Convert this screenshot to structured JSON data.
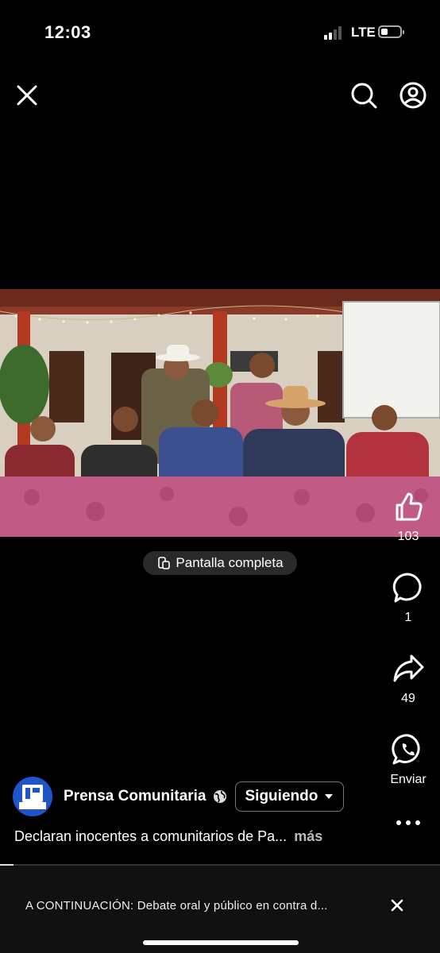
{
  "status_bar": {
    "time": "12:03",
    "network": "LTE",
    "battery_level": 0.35
  },
  "header": {
    "close_icon": "close-icon",
    "search_icon": "search-icon",
    "profile_icon": "profile-icon"
  },
  "video": {
    "fullscreen_label": "Pantalla completa",
    "progress": 0.03
  },
  "actions": {
    "like_count": "103",
    "comment_count": "1",
    "share_count": "49",
    "send_label": "Enviar"
  },
  "post": {
    "author": "Prensa Comunitaria",
    "avatar_text": "Prensa",
    "follow_label": "Siguiendo",
    "caption": "Declaran inocentes a comunitarios de Pa...",
    "more_label": "más"
  },
  "up_next": {
    "text": "A CONTINUACIÓN: Debate oral y público en contra d..."
  },
  "colors": {
    "background": "#000000",
    "tablecloth": "#c25a86",
    "avatar": "#1f55c8"
  }
}
